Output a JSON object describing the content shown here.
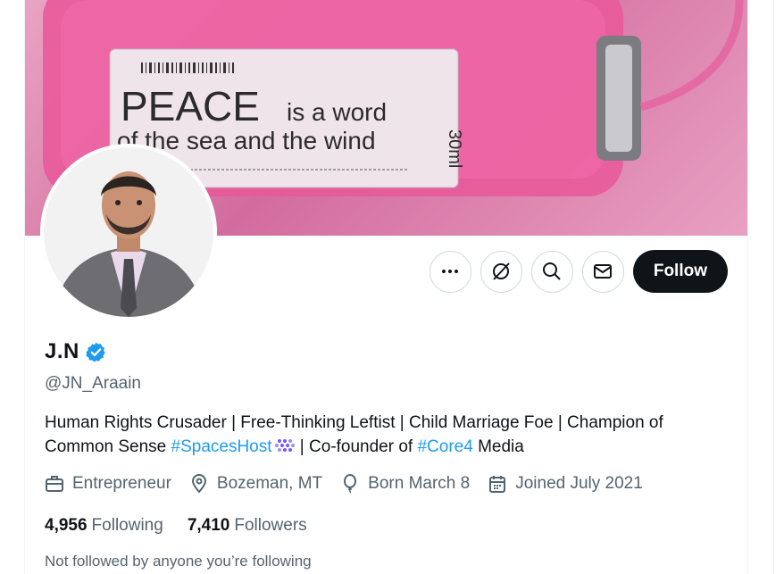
{
  "banner": {
    "label_main": "PEACE",
    "label_line1_rest": "is a word",
    "label_line2": "of the sea and the wind",
    "label_volume": "30ml"
  },
  "actions": {
    "more_icon": "more-dots-icon",
    "subscribe_icon": "no-notify-icon",
    "search_icon": "search-icon",
    "message_icon": "envelope-icon",
    "follow_label": "Follow"
  },
  "profile": {
    "display_name": "J.N",
    "verified_icon": "verified-badge-icon",
    "handle": "@JN_Araain",
    "bio": {
      "text1": "Human Rights Crusader | Free-Thinking Leftist | Child Marriage Foe | Champion of Common Sense ",
      "hashtag1": "#SpacesHost",
      "text2": " | Co-founder of ",
      "hashtag2": "#Core4",
      "text3": " Media"
    },
    "meta": {
      "profession": "Entrepreneur",
      "location": "Bozeman, MT",
      "birthday": "Born March 8",
      "joined": "Joined July 2021"
    },
    "stats": {
      "following_count": "4,956",
      "following_label": "Following",
      "followers_count": "7,410",
      "followers_label": "Followers"
    },
    "not_followed": "Not followed by anyone you’re following"
  },
  "colors": {
    "accent": "#1d9bf0",
    "text": "#0f1419",
    "muted": "#536471",
    "button_dark": "#0f1419"
  }
}
